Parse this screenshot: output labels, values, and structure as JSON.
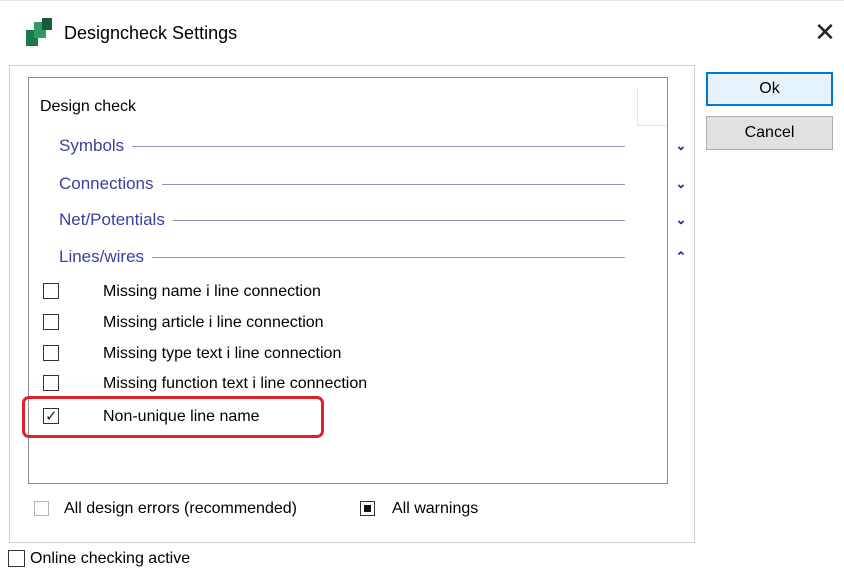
{
  "window": {
    "title": "Designcheck Settings",
    "close_glyph": "✕"
  },
  "list": {
    "header": "Design check",
    "sections": [
      {
        "label": "Symbols",
        "expanded": false,
        "chevron": "⌄"
      },
      {
        "label": "Connections",
        "expanded": false,
        "chevron": "⌄"
      },
      {
        "label": "Net/Potentials",
        "expanded": false,
        "chevron": "⌄"
      },
      {
        "label": "Lines/wires",
        "expanded": true,
        "chevron": "⌃"
      }
    ],
    "items": [
      {
        "label": "Missing name i line connection",
        "checked": false
      },
      {
        "label": "Missing article i line connection",
        "checked": false
      },
      {
        "label": "Missing type text i line connection",
        "checked": false
      },
      {
        "label": "Missing function text i line connection",
        "checked": false
      },
      {
        "label": "Non-unique line name",
        "checked": true
      }
    ]
  },
  "filters": {
    "all_errors_label": "All design errors (recommended)",
    "all_errors_state": "unchecked",
    "all_warnings_label": "All warnings",
    "all_warnings_state": "indeterminate"
  },
  "online_checking": {
    "label": "Online checking active",
    "checked": false
  },
  "buttons": {
    "ok": "Ok",
    "cancel": "Cancel"
  },
  "colors": {
    "section_text": "#3b3fa0",
    "highlight": "#e0202a",
    "default_button_border": "#0078d7"
  }
}
